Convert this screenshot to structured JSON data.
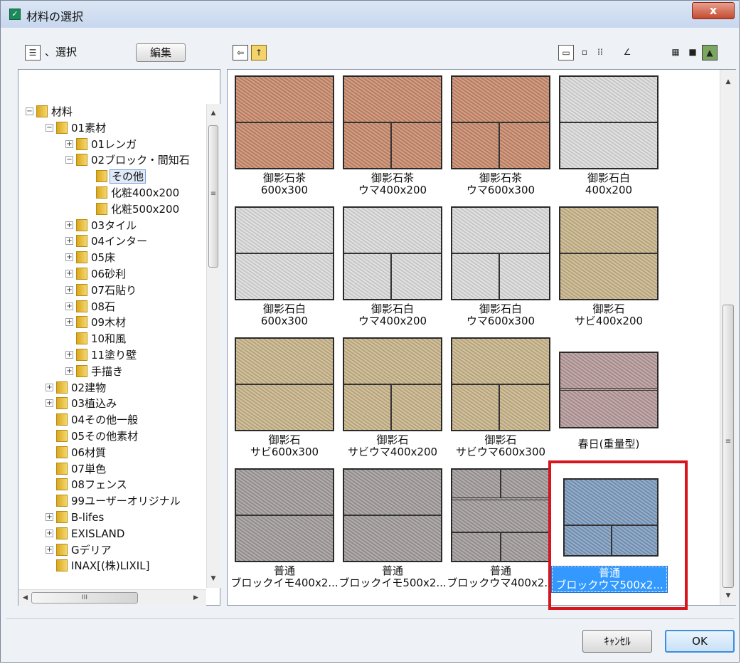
{
  "window": {
    "title": "材料の選択",
    "close_label": "x"
  },
  "toolbar": {
    "mode_label": "、選択",
    "edit_label": "編集"
  },
  "tree": {
    "items": [
      {
        "label": "材料",
        "depth": 0,
        "expander": "−"
      },
      {
        "label": "01素材",
        "depth": 1,
        "expander": "−"
      },
      {
        "label": "01レンガ",
        "depth": 2,
        "expander": "+"
      },
      {
        "label": "02ブロック・間知石",
        "depth": 2,
        "expander": "−"
      },
      {
        "label": "その他",
        "depth": 3,
        "expander": "",
        "selected": true
      },
      {
        "label": "化粧400x200",
        "depth": 3,
        "expander": ""
      },
      {
        "label": "化粧500x200",
        "depth": 3,
        "expander": ""
      },
      {
        "label": "03タイル",
        "depth": 2,
        "expander": "+"
      },
      {
        "label": "04インター",
        "depth": 2,
        "expander": "+"
      },
      {
        "label": "05床",
        "depth": 2,
        "expander": "+"
      },
      {
        "label": "06砂利",
        "depth": 2,
        "expander": "+"
      },
      {
        "label": "07石貼り",
        "depth": 2,
        "expander": "+"
      },
      {
        "label": "08石",
        "depth": 2,
        "expander": "+"
      },
      {
        "label": "09木材",
        "depth": 2,
        "expander": "+"
      },
      {
        "label": "10和風",
        "depth": 2,
        "expander": ""
      },
      {
        "label": "11塗り壁",
        "depth": 2,
        "expander": "+"
      },
      {
        "label": "手描き",
        "depth": 2,
        "expander": "+"
      },
      {
        "label": "02建物",
        "depth": 1,
        "expander": "+"
      },
      {
        "label": "03植込み",
        "depth": 1,
        "expander": "+"
      },
      {
        "label": "04その他一般",
        "depth": 1,
        "expander": ""
      },
      {
        "label": "05その他素材",
        "depth": 1,
        "expander": ""
      },
      {
        "label": "06材質",
        "depth": 1,
        "expander": ""
      },
      {
        "label": "07単色",
        "depth": 1,
        "expander": ""
      },
      {
        "label": "08フェンス",
        "depth": 1,
        "expander": ""
      },
      {
        "label": "99ユーザーオリジナル",
        "depth": 1,
        "expander": ""
      },
      {
        "label": "B-lifes",
        "depth": 1,
        "expander": "+"
      },
      {
        "label": "EXISLAND",
        "depth": 1,
        "expander": "+"
      },
      {
        "label": "Gデリア",
        "depth": 1,
        "expander": "+"
      },
      {
        "label": "INAX[(株)LIXIL]",
        "depth": 1,
        "expander": ""
      }
    ],
    "scroll_marker": "≡",
    "hscroll_grip": "III"
  },
  "materials": [
    {
      "line1": "御影石茶",
      "line2": "600x300",
      "color": "#c98a6c",
      "pattern": "ryobu"
    },
    {
      "line1": "御影石茶",
      "line2": "ウマ400x200",
      "color": "#c98a6c",
      "pattern": "uma"
    },
    {
      "line1": "御影石茶",
      "line2": "ウマ600x300",
      "color": "#c98a6c",
      "pattern": "uma"
    },
    {
      "line1": "御影石白",
      "line2": "400x200",
      "color": "#dcdcdc",
      "pattern": "ryobu"
    },
    {
      "line1": "御影石白",
      "line2": "600x300",
      "color": "#dcdcdc",
      "pattern": "ryobu"
    },
    {
      "line1": "御影石白",
      "line2": "ウマ400x200",
      "color": "#dcdcdc",
      "pattern": "uma"
    },
    {
      "line1": "御影石白",
      "line2": "ウマ600x300",
      "color": "#dcdcdc",
      "pattern": "uma"
    },
    {
      "line1": "御影石",
      "line2": "サビ400x200",
      "color": "#c9b58a",
      "pattern": "ryobu"
    },
    {
      "line1": "御影石",
      "line2": "サビ600x300",
      "color": "#c9b58a",
      "pattern": "ryobu"
    },
    {
      "line1": "御影石",
      "line2": "サビウマ400x200",
      "color": "#c9b58a",
      "pattern": "uma"
    },
    {
      "line1": "御影石",
      "line2": "サビウマ600x300",
      "color": "#c9b58a",
      "pattern": "uma"
    },
    {
      "line1": "春日(重量型)",
      "line2": "",
      "color": "#b79a9a",
      "pattern": "kasuga"
    },
    {
      "line1": "普通",
      "line2": "ブロックイモ400x2...",
      "color": "#a29c9c",
      "pattern": "ryobu"
    },
    {
      "line1": "普通",
      "line2": "ブロックイモ500x2...",
      "color": "#a29c9c",
      "pattern": "ryobu"
    },
    {
      "line1": "普通",
      "line2": "ブロックウマ400x2...",
      "color": "#a29c9c",
      "pattern": "uma3"
    },
    {
      "line1": "普通",
      "line2": "ブロックウマ500x2...",
      "color": "#7e9cc0",
      "pattern": "uma",
      "selected": true
    }
  ],
  "footer": {
    "cancel_label": "ｷｬﾝｾﾙ",
    "ok_label": "OK"
  }
}
